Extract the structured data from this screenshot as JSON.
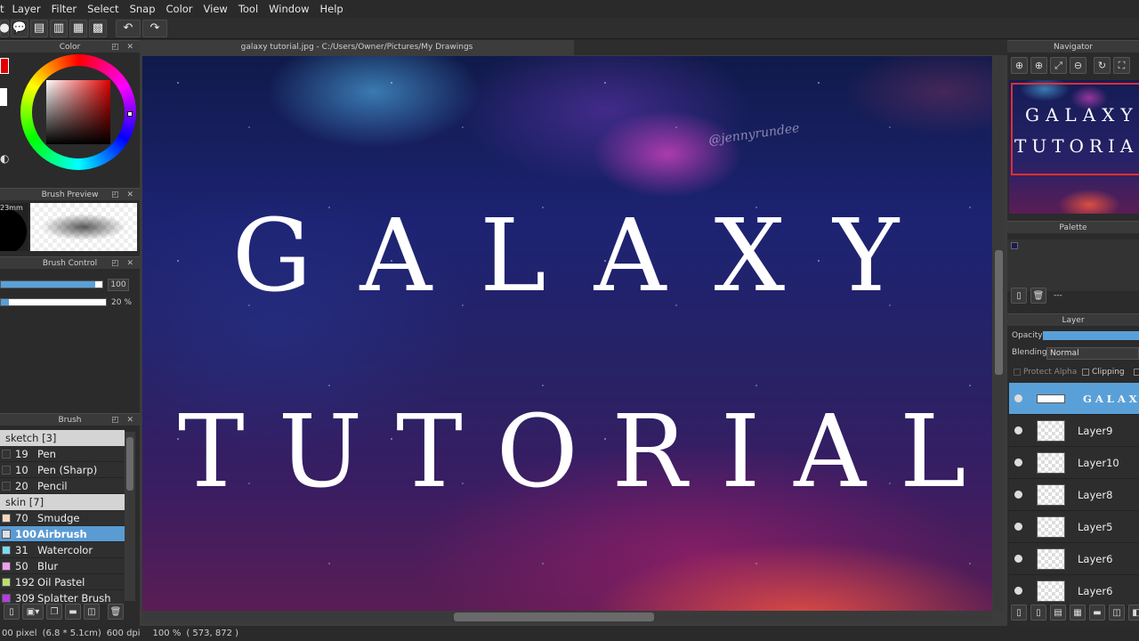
{
  "menu": [
    "Layer",
    "Filter",
    "Select",
    "Snap",
    "Color",
    "View",
    "Tool",
    "Window",
    "Help"
  ],
  "document_tab": "galaxy tutorial.jpg - C:/Users/Owner/Pictures/My Drawings",
  "canvas": {
    "line1": "GALAXY",
    "line2": "TUTORIAL",
    "signature": "@jennyrundee"
  },
  "panels": {
    "color": "Color",
    "brush_preview": "Brush Preview",
    "brush_control": "Brush Control",
    "brush": "Brush",
    "navigator": "Navigator",
    "palette": "Palette",
    "layer": "Layer"
  },
  "brush_preview": {
    "size_label": "23mm"
  },
  "brush_control": {
    "size_value": "100",
    "density_value": "20 %",
    "size_fraction": 0.93,
    "density_fraction": 0.08
  },
  "brush_list": {
    "groups": [
      {
        "name": "sketch [3]",
        "items": [
          {
            "size": "19",
            "name": "Pen",
            "color": "#333333"
          },
          {
            "size": "10",
            "name": "Pen (Sharp)",
            "color": "#333333"
          },
          {
            "size": "20",
            "name": "Pencil",
            "color": "#333333"
          }
        ]
      },
      {
        "name": "skin [7]",
        "items": [
          {
            "size": "70",
            "name": "Smudge",
            "color": "#f2d6c0"
          },
          {
            "size": "100",
            "name": "Airbrush",
            "color": "#e0e0e0",
            "selected": true
          },
          {
            "size": "31",
            "name": "Watercolor",
            "color": "#7fd8f0"
          },
          {
            "size": "50",
            "name": "Blur",
            "color": "#f0a0f0"
          },
          {
            "size": "192",
            "name": "Oil Pastel",
            "color": "#b8e070"
          },
          {
            "size": "309",
            "name": "Splatter Brush",
            "color": "#b040e0"
          }
        ]
      }
    ]
  },
  "palette": {
    "value": "---"
  },
  "layer_panel": {
    "opacity_label": "Opacity",
    "blending_label": "Blending",
    "blending_value": "Normal",
    "protect_alpha": "Protect Alpha",
    "clipping": "Clipping",
    "layers": [
      {
        "name": "GALAXY",
        "selected": true
      },
      {
        "name": "Layer9"
      },
      {
        "name": "Layer10"
      },
      {
        "name": "Layer8"
      },
      {
        "name": "Layer5"
      },
      {
        "name": "Layer6"
      },
      {
        "name": "Layer6"
      }
    ]
  },
  "status": {
    "size": "00 pixel",
    "cm": "(6.8 * 5.1cm)",
    "dpi": "600 dpi",
    "zoom": "100 %",
    "coords": "( 573, 872 )"
  }
}
